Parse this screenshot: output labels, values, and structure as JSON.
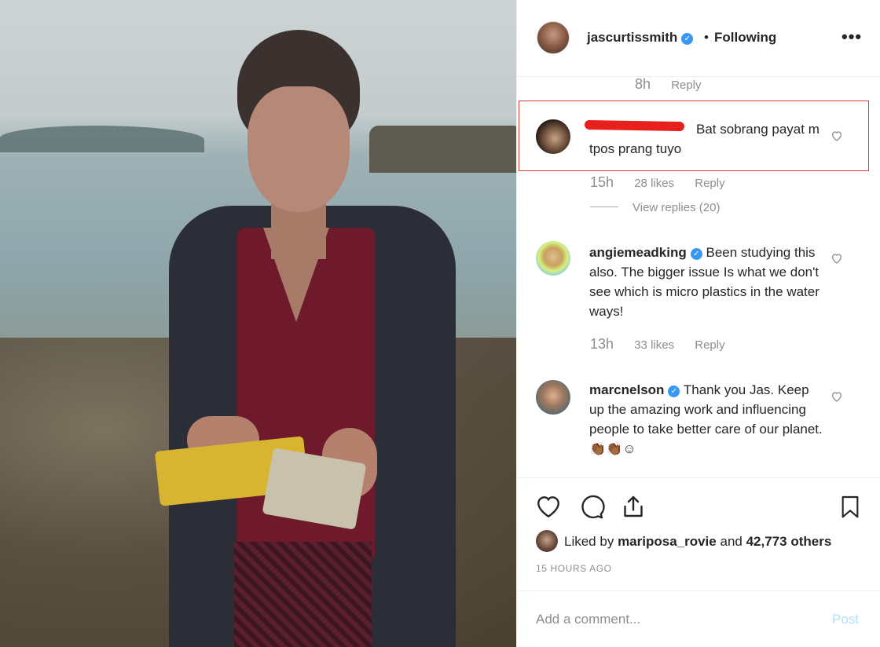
{
  "post": {
    "author": "jascurtissmith",
    "separator": "•",
    "follow_status": "Following",
    "more_label": "•••"
  },
  "comments": [
    {
      "time": "8h",
      "reply": "Reply"
    },
    {
      "username": "",
      "text": "Bat sobrang payat m tpos prang tuyo",
      "time": "15h",
      "likes": "28 likes",
      "reply": "Reply",
      "view_replies": "View replies (20)"
    },
    {
      "username": "angiemeadking",
      "text": "Been studying this also. The bigger issue Is what we don't see which is micro plastics in the water ways!",
      "time": "13h",
      "likes": "33 likes",
      "reply": "Reply"
    },
    {
      "username": "marcnelson",
      "text": "Thank you Jas. Keep up the amazing work and influencing people to take better care of our planet. 👏🏾👏🏾☺"
    }
  ],
  "likes": {
    "prefix": "Liked by",
    "user": "mariposa_rovie",
    "middle": "and",
    "count": "42,773 others"
  },
  "time_ago": "15 HOURS AGO",
  "comment_box": {
    "placeholder": "Add a comment...",
    "post_label": "Post"
  },
  "colors": {
    "verified": "#3897f0",
    "highlight_border": "#d8403a",
    "redaction": "#e8201c"
  }
}
